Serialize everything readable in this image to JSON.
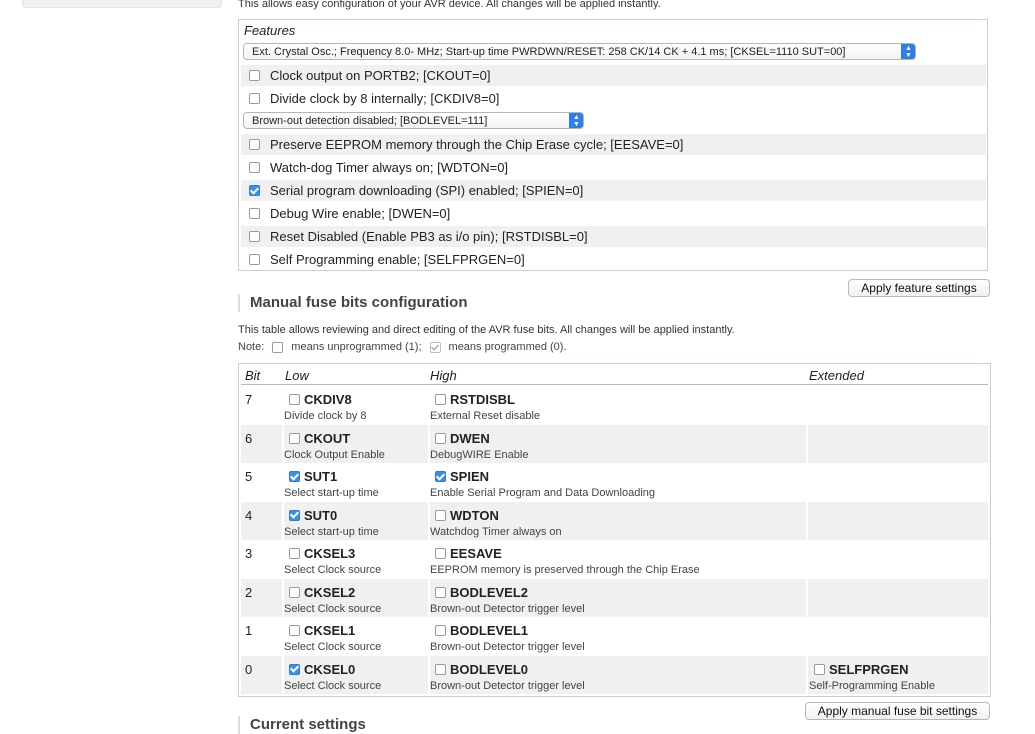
{
  "intro_text": "This allows easy configuration of your AVR device. All changes will be applied instantly.",
  "features": {
    "legend": "Features",
    "clock_select": "Ext. Crystal Osc.; Frequency 8.0- MHz; Start-up time PWRDWN/RESET: 258 CK/14 CK + 4.1 ms; [CKSEL=1110 SUT=00]",
    "clock_output": {
      "label": "Clock output on PORTB2; [CKOUT=0]",
      "checked": false
    },
    "divide_clock": {
      "label": "Divide clock by 8 internally; [CKDIV8=0]",
      "checked": false
    },
    "brownout_select": "Brown-out detection disabled; [BODLEVEL=111]",
    "options": [
      {
        "label": "Preserve EEPROM memory through the Chip Erase cycle; [EESAVE=0]",
        "checked": false
      },
      {
        "label": "Watch-dog Timer always on; [WDTON=0]",
        "checked": false
      },
      {
        "label": "Serial program downloading (SPI) enabled; [SPIEN=0]",
        "checked": true
      },
      {
        "label": "Debug Wire enable; [DWEN=0]",
        "checked": false
      },
      {
        "label": "Reset Disabled (Enable PB3 as i/o pin); [RSTDISBL=0]",
        "checked": false
      },
      {
        "label": "Self Programming enable; [SELFPRGEN=0]",
        "checked": false
      }
    ],
    "apply_label": "Apply feature settings"
  },
  "manual": {
    "title": "Manual fuse bits configuration",
    "description": "This table allows reviewing and direct editing of the AVR fuse bits. All changes will be applied instantly.",
    "note_prefix": "Note:",
    "note_unprogrammed": "means unprogrammed (1);",
    "note_programmed": "means programmed (0).",
    "headers": {
      "bit": "Bit",
      "low": "Low",
      "high": "High",
      "extended": "Extended"
    },
    "rows": [
      {
        "bit": "7",
        "low": {
          "name": "CKDIV8",
          "desc": "Divide clock by 8",
          "checked": false
        },
        "high": {
          "name": "RSTDISBL",
          "desc": "External Reset disable",
          "checked": false
        },
        "ext": null
      },
      {
        "bit": "6",
        "low": {
          "name": "CKOUT",
          "desc": "Clock Output Enable",
          "checked": false
        },
        "high": {
          "name": "DWEN",
          "desc": "DebugWIRE Enable",
          "checked": false
        },
        "ext": null
      },
      {
        "bit": "5",
        "low": {
          "name": "SUT1",
          "desc": "Select start-up time",
          "checked": true
        },
        "high": {
          "name": "SPIEN",
          "desc": "Enable Serial Program and Data Downloading",
          "checked": true
        },
        "ext": null
      },
      {
        "bit": "4",
        "low": {
          "name": "SUT0",
          "desc": "Select start-up time",
          "checked": true
        },
        "high": {
          "name": "WDTON",
          "desc": "Watchdog Timer always on",
          "checked": false
        },
        "ext": null
      },
      {
        "bit": "3",
        "low": {
          "name": "CKSEL3",
          "desc": "Select Clock source",
          "checked": false
        },
        "high": {
          "name": "EESAVE",
          "desc": "EEPROM memory is preserved through the Chip Erase",
          "checked": false
        },
        "ext": null
      },
      {
        "bit": "2",
        "low": {
          "name": "CKSEL2",
          "desc": "Select Clock source",
          "checked": false
        },
        "high": {
          "name": "BODLEVEL2",
          "desc": "Brown-out Detector trigger level",
          "checked": false
        },
        "ext": null
      },
      {
        "bit": "1",
        "low": {
          "name": "CKSEL1",
          "desc": "Select Clock source",
          "checked": false
        },
        "high": {
          "name": "BODLEVEL1",
          "desc": "Brown-out Detector trigger level",
          "checked": false
        },
        "ext": null
      },
      {
        "bit": "0",
        "low": {
          "name": "CKSEL0",
          "desc": "Select Clock source",
          "checked": true
        },
        "high": {
          "name": "BODLEVEL0",
          "desc": "Brown-out Detector trigger level",
          "checked": false
        },
        "ext": {
          "name": "SELFPRGEN",
          "desc": "Self-Programming Enable",
          "checked": false
        }
      }
    ],
    "apply_label": "Apply manual fuse bit settings"
  },
  "current_settings_title": "Current settings",
  "colors": {
    "accent": "#3b8fe6",
    "row_shade": "#f0f0f0"
  }
}
